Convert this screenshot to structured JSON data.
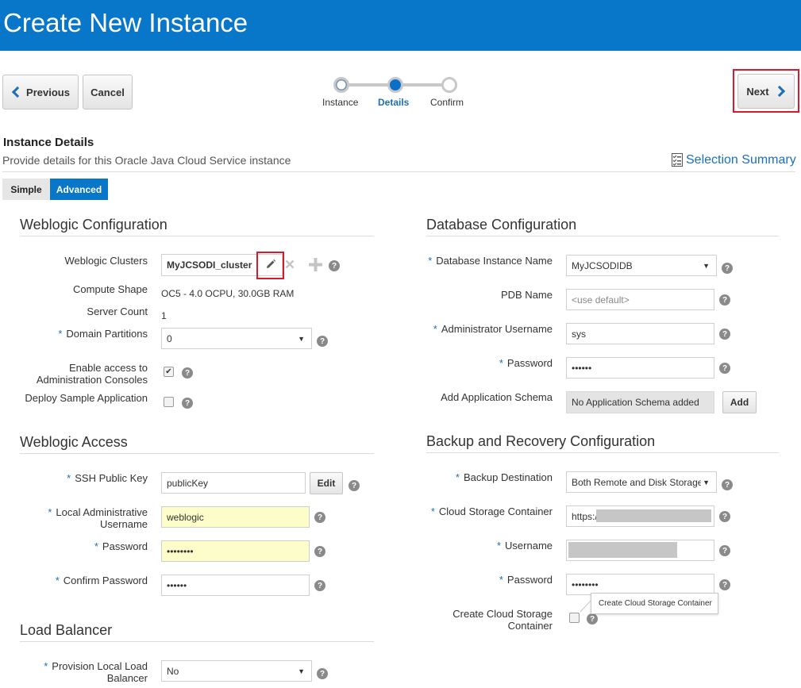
{
  "header": {
    "title": "Create New Instance",
    "color": "#0876c9"
  },
  "nav": {
    "previous_label": "Previous",
    "cancel_label": "Cancel",
    "next_label": "Next"
  },
  "train": {
    "steps": [
      {
        "label": "Instance",
        "state": "visited"
      },
      {
        "label": "Details",
        "state": "current"
      },
      {
        "label": "Confirm",
        "state": "pending"
      }
    ]
  },
  "details": {
    "title": "Instance Details",
    "description": "Provide details for this Oracle Java Cloud Service instance",
    "summary_link": "Selection Summary"
  },
  "tabs": [
    {
      "label": "Simple",
      "active": false
    },
    {
      "label": "Advanced",
      "active": true
    }
  ],
  "weblogic_config": {
    "heading": "Weblogic Configuration",
    "clusters_label": "Weblogic Clusters",
    "cluster_name": "MyJCSODI_cluster",
    "compute_shape_label": "Compute Shape",
    "compute_shape_value": "OC5 - 4.0 OCPU, 30.0GB RAM",
    "server_count_label": "Server Count",
    "server_count_value": "1",
    "domain_partitions_label": "Domain Partitions",
    "domain_partitions_value": "0",
    "enable_access_label_1": "Enable access to",
    "enable_access_label_2": "Administration Consoles",
    "enable_access_checked": true,
    "deploy_sample_label": "Deploy Sample Application",
    "deploy_sample_checked": false
  },
  "weblogic_access": {
    "heading": "Weblogic Access",
    "ssh_key_label": "SSH Public Key",
    "ssh_key_value": "publicKey",
    "edit_label": "Edit",
    "local_admin_label_1": "Local Administrative",
    "local_admin_label_2": "Username",
    "local_admin_value": "weblogic",
    "password_label": "Password",
    "password_value": "••••••••",
    "confirm_password_label": "Confirm Password",
    "confirm_password_value": "••••••"
  },
  "load_balancer": {
    "heading": "Load Balancer",
    "provision_label_1": "Provision Local Load",
    "provision_label_2": "Balancer",
    "provision_value": "No"
  },
  "database_config": {
    "heading": "Database Configuration",
    "db_instance_label": "Database Instance Name",
    "db_instance_value": "MyJCSODIDB",
    "pdb_label": "PDB Name",
    "pdb_placeholder": "<use default>",
    "admin_user_label": "Administrator Username",
    "admin_user_value": "sys",
    "password_label": "Password",
    "password_value": "••••••",
    "app_schema_label": "Add Application Schema",
    "app_schema_value": "No Application Schema added",
    "add_label": "Add"
  },
  "backup": {
    "heading": "Backup and Recovery Configuration",
    "destination_label": "Backup Destination",
    "destination_value": "Both Remote and Disk Storage",
    "container_label": "Cloud Storage Container",
    "container_value": "https:/",
    "username_label": "Username",
    "password_label": "Password",
    "password_value": "••••••••",
    "create_container_label_1": "Create Cloud Storage",
    "create_container_label_2": "Container",
    "create_container_checked": false,
    "tooltip": "Create Cloud Storage Container"
  },
  "required_marker": "*",
  "help_glyph": "?",
  "select_arrow": "▼",
  "icons": {
    "edit": "pencil-icon",
    "delete": "close-icon",
    "add": "plus-icon",
    "summary": "checklist-icon",
    "help": "help-icon"
  }
}
